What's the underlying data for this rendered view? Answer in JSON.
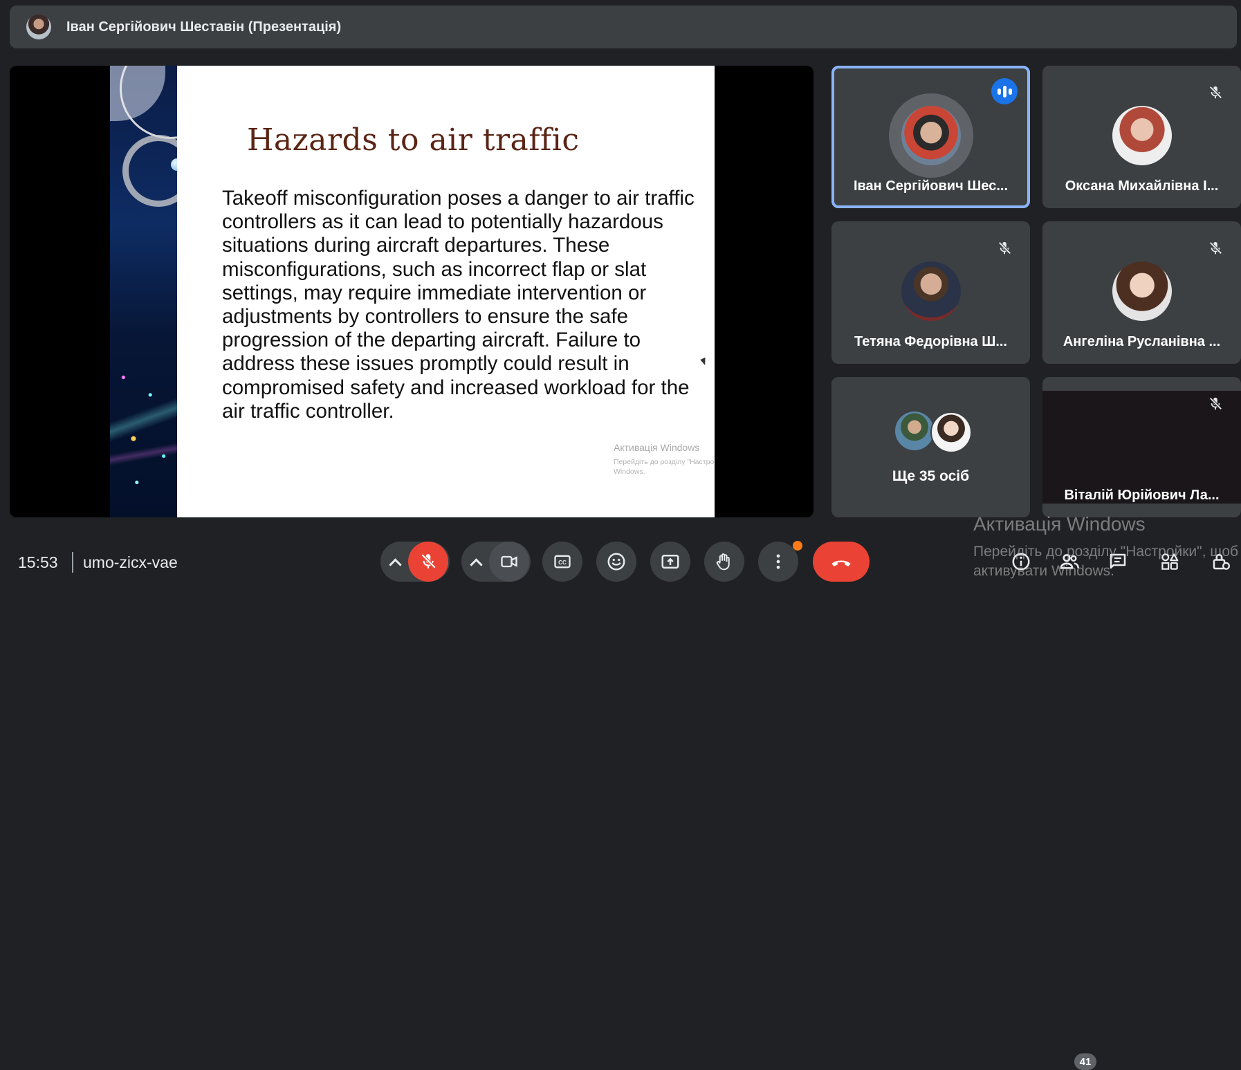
{
  "header": {
    "presenter_title": "Іван Сергійович Шеставін (Презентація)"
  },
  "slide": {
    "title": "Hazards to air traffic",
    "body": "Takeoff misconfiguration poses a danger to air traffic controllers as it can lead to potentially hazardous situations during aircraft departures. These misconfigurations, such as incorrect flap or slat settings, may require immediate intervention or adjustments by controllers to ensure the safe progression of the departing aircraft. Failure to address these issues promptly could result in compromised safety and increased workload for the air traffic controller.",
    "watermark_title": "Активація Windows",
    "watermark_text": "Перейдіть до розділу \"Настройки\", щоб активувати Windows."
  },
  "participants": [
    {
      "name": "Іван Сергійович Шес...",
      "state": "speaking"
    },
    {
      "name": "Оксана Михайлівна І...",
      "state": "muted"
    },
    {
      "name": "Тетяна Федорівна Ш...",
      "state": "muted"
    },
    {
      "name": "Ангеліна Русланівна ...",
      "state": "muted"
    },
    {
      "name": "Ще 35 осіб",
      "state": "group"
    },
    {
      "name": "Віталій Юрійович Ла...",
      "state": "muted"
    }
  ],
  "footer": {
    "time": "15:53",
    "meeting_code": "umo-zicx-vae",
    "participants_count": "41",
    "watermark_title": "Активація Windows",
    "watermark_text": "Перейдіть до розділу \"Настройки\", щоб активувати Windows."
  },
  "colors": {
    "accent": "#8ab4f8",
    "speaking": "#1a73e8",
    "danger": "#ea4335",
    "notification": "#fa7b17"
  },
  "icons": [
    "mic-off-icon",
    "camera-icon",
    "captions-icon",
    "emoji-icon",
    "present-icon",
    "raise-hand-icon",
    "more-options-icon",
    "end-call-icon",
    "info-icon",
    "people-icon",
    "chat-icon",
    "activities-icon",
    "host-controls-icon"
  ]
}
